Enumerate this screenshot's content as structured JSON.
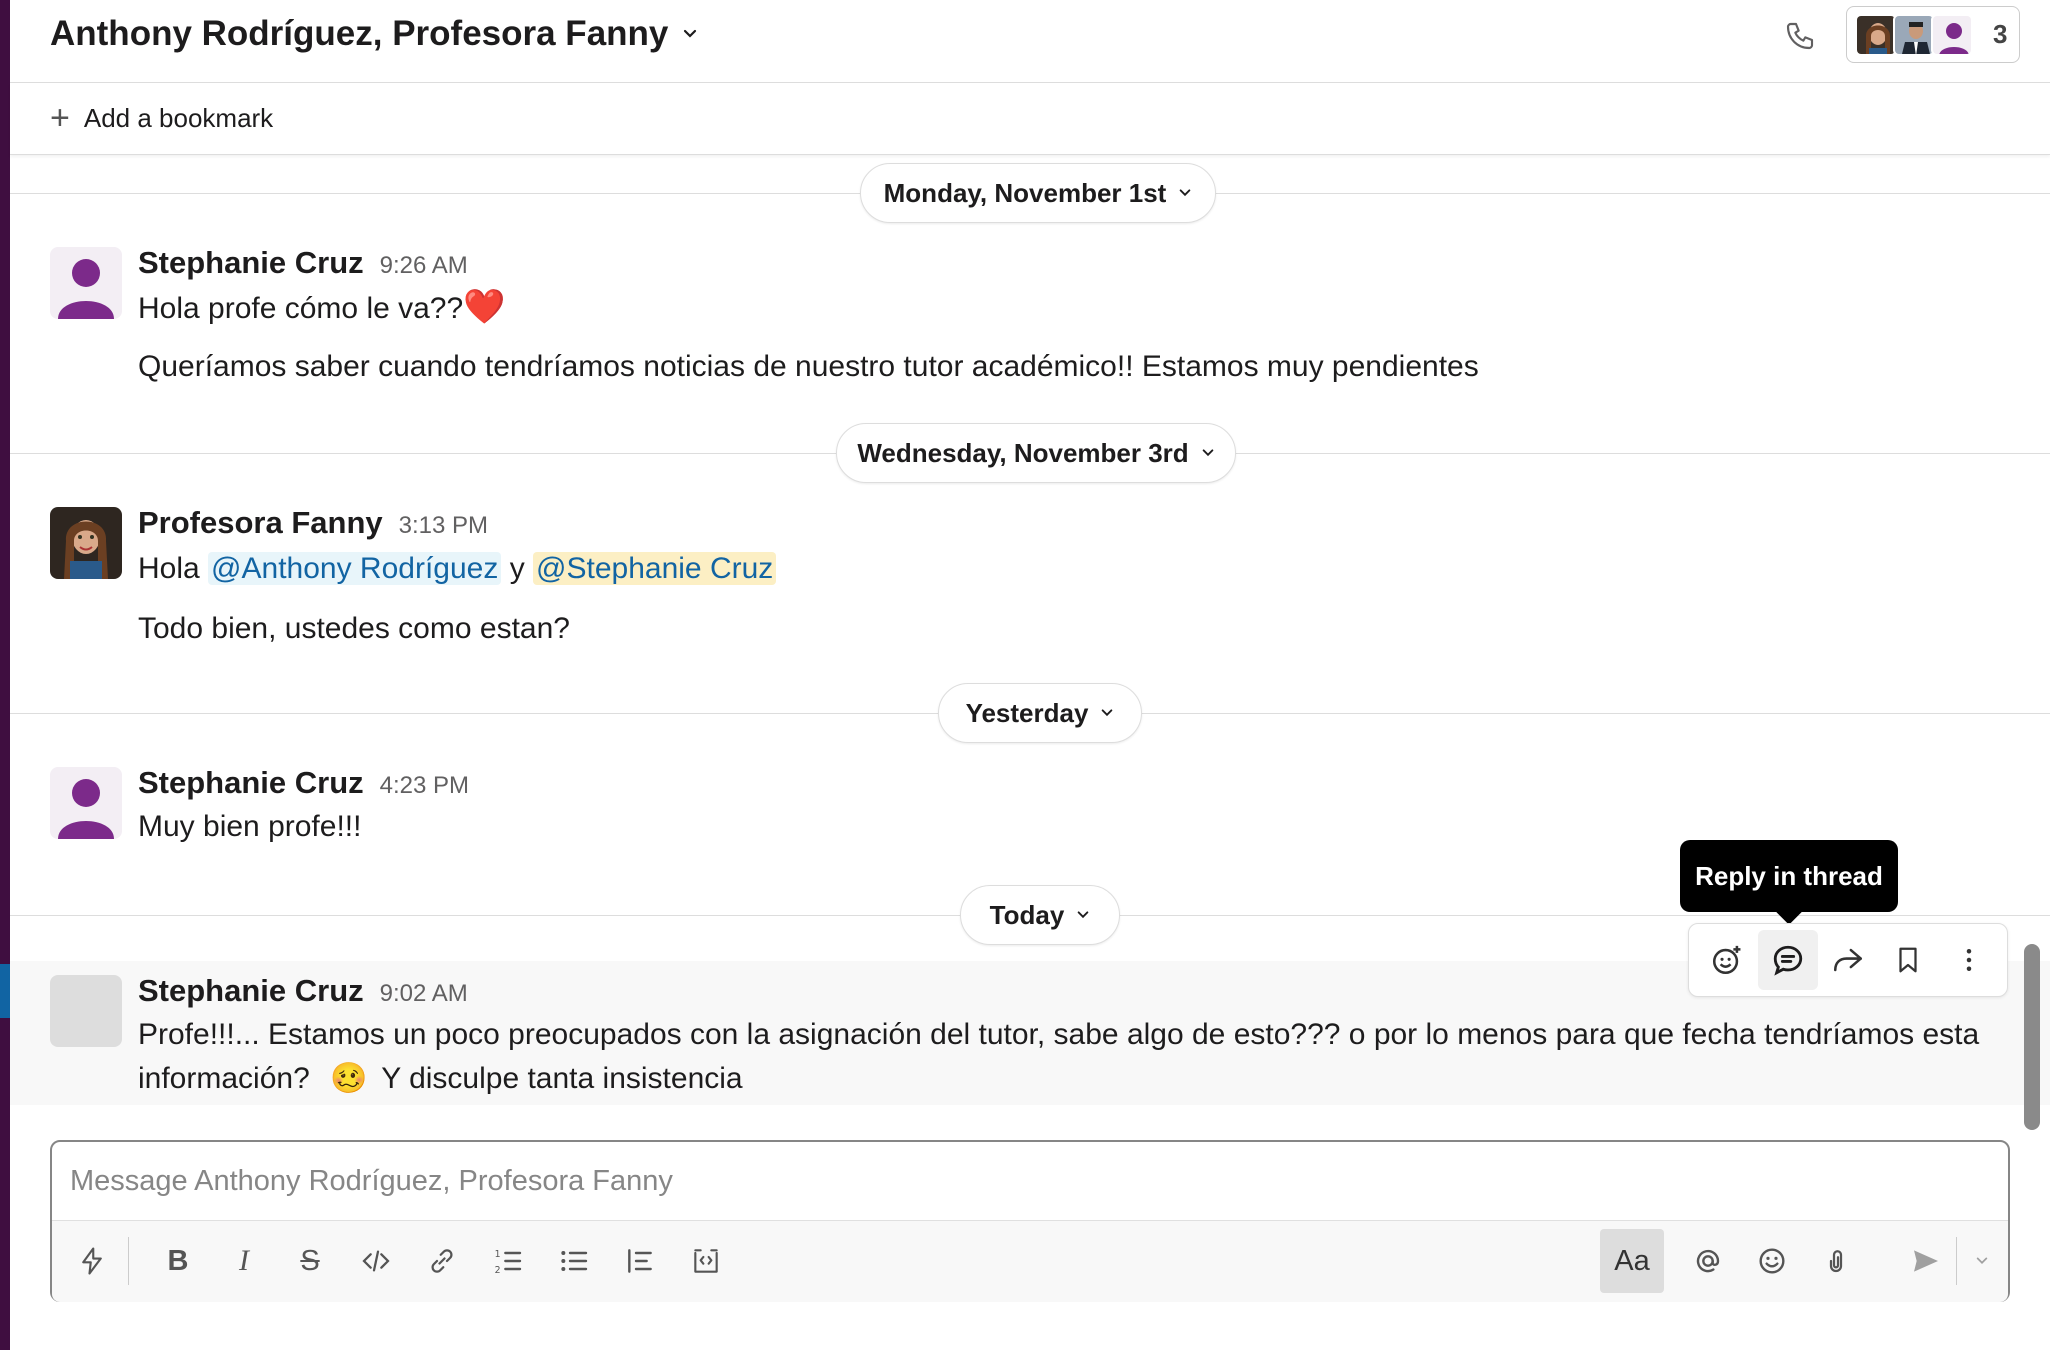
{
  "header": {
    "channel_title": "Anthony Rodríguez, Profesora Fanny",
    "member_count": "3"
  },
  "bookmarks": {
    "add_label": "Add a bookmark"
  },
  "date_dividers": [
    "Monday, November 1st",
    "Wednesday, November 3rd",
    "Yesterday",
    "Today"
  ],
  "messages": [
    {
      "sender": "Stephanie Cruz",
      "time": "9:26 AM",
      "line1": "Hola profe cómo le va??",
      "line1_emoji": "❤️",
      "line2": "Queríamos saber cuando tendríamos noticias de nuestro tutor académico!! Estamos muy pendientes"
    },
    {
      "sender": "Profesora Fanny",
      "time": "3:13 PM",
      "greeting": "Hola",
      "mention1": "@Anthony Rodríguez",
      "connector": "y",
      "mention2": "@Stephanie Cruz",
      "line2": "Todo bien, ustedes como estan?"
    },
    {
      "sender": "Stephanie Cruz",
      "time": "4:23 PM",
      "line1": "Muy bien profe!!!"
    },
    {
      "sender": "Stephanie Cruz",
      "time": "9:02 AM",
      "line1": "Profe!!!... Estamos un poco preocupados con la asignación del tutor, sabe algo de esto??? o por lo menos para que fecha tendríamos esta",
      "line2_a": "información?",
      "emoji": "🥴",
      "line2_b": "Y disculpe tanta insistencia"
    }
  ],
  "tooltip": "Reply in thread",
  "composer": {
    "placeholder": "Message Anthony Rodríguez, Profesora Fanny",
    "format_label": "Aa"
  },
  "colors": {
    "workspace": "#3f0e40",
    "mention_bg": "#e8f5fa",
    "mention_text": "#1264a3",
    "self_mention_bg": "#fcefc4",
    "avatar_purple": "#7c2a8a"
  }
}
